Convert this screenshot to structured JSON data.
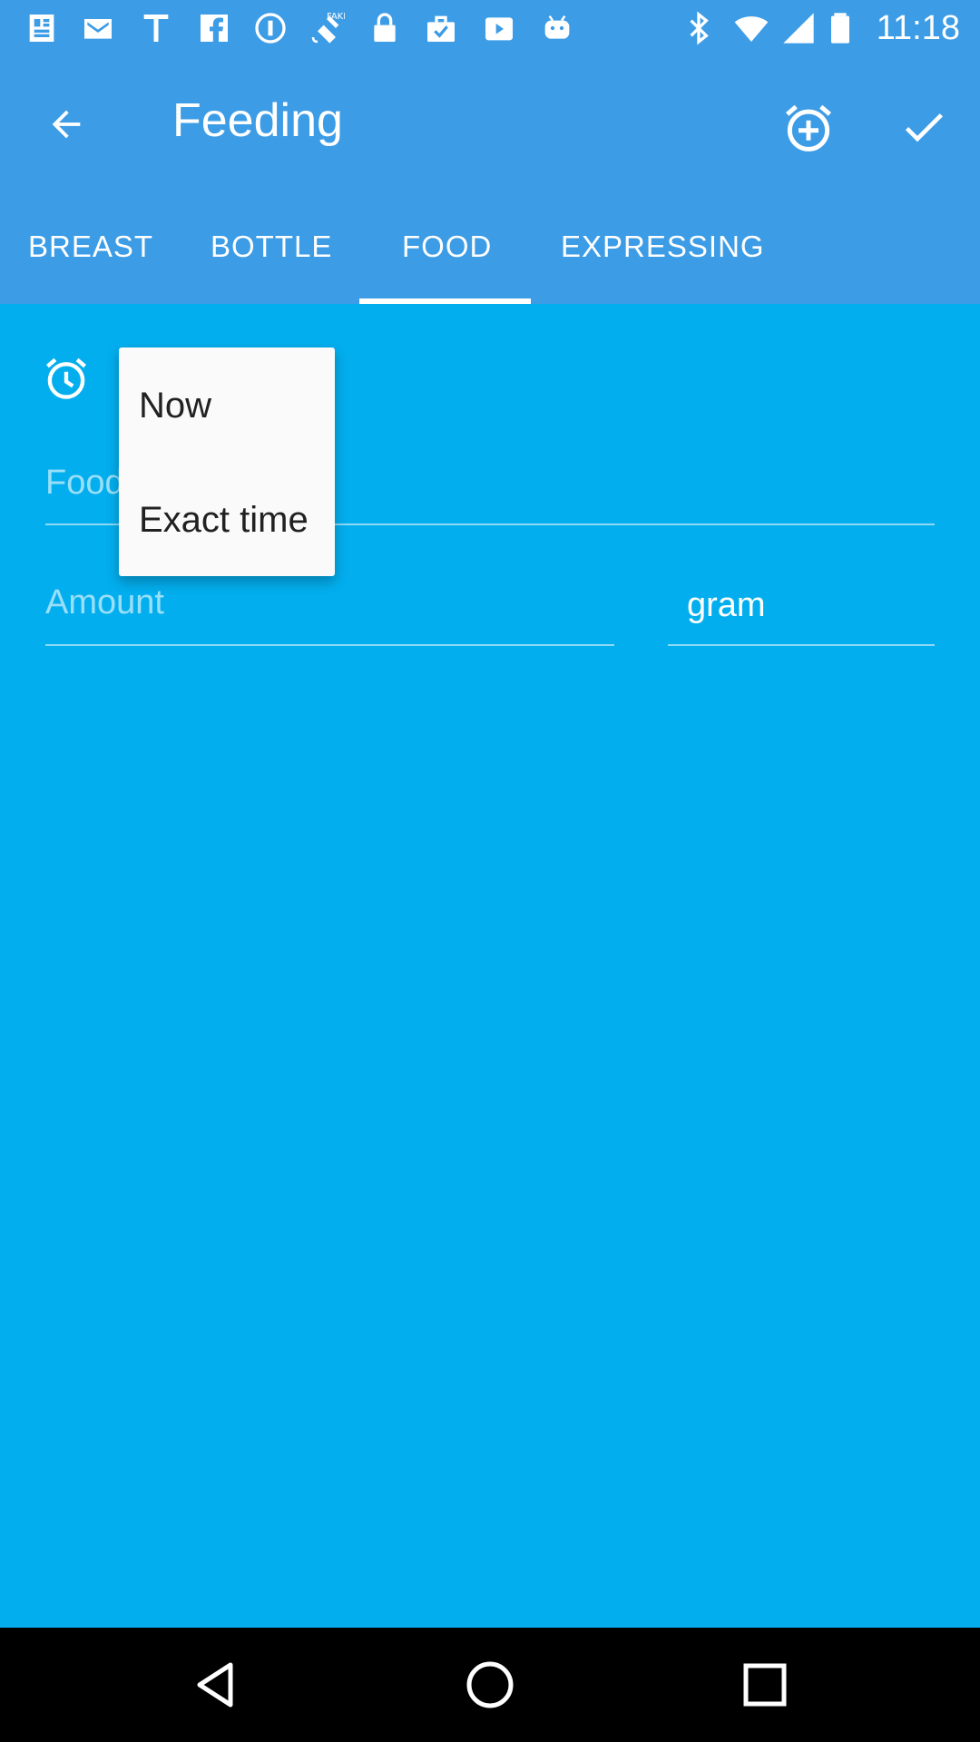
{
  "status_bar": {
    "time": "11:18",
    "left_icons": [
      "news-icon",
      "mail-icon",
      "text-icon",
      "facebook-icon",
      "info-circle-icon",
      "fake-gps-icon",
      "lock-icon",
      "briefcase-check-icon",
      "video-icon",
      "android-icon"
    ],
    "right_icons": [
      "bluetooth-icon",
      "wifi-icon",
      "signal-icon",
      "battery-icon"
    ]
  },
  "app_bar": {
    "title": "Feeding",
    "back_icon": "arrow-back-icon",
    "add_alarm_icon": "alarm-add-icon",
    "confirm_icon": "check-icon"
  },
  "tabs": [
    {
      "label": "BREAST",
      "selected": false
    },
    {
      "label": "BOTTLE",
      "selected": false
    },
    {
      "label": "FOOD",
      "selected": true
    },
    {
      "label": "EXPRESSING",
      "selected": false
    }
  ],
  "form": {
    "time_icon": "alarm-clock-icon",
    "food_placeholder": "Food",
    "amount_placeholder": "Amount",
    "unit_value": "gram"
  },
  "popup_menu": {
    "items": [
      "Now",
      "Exact time"
    ]
  },
  "nav_bar": {
    "back_icon": "nav-back-icon",
    "home_icon": "nav-home-icon",
    "recents_icon": "nav-recents-icon"
  },
  "colors": {
    "background": "#03AEEE",
    "header": "#3C9CE6",
    "popup_bg": "#FAFAFA",
    "popup_text": "#212121",
    "nav_bar": "#000000"
  }
}
